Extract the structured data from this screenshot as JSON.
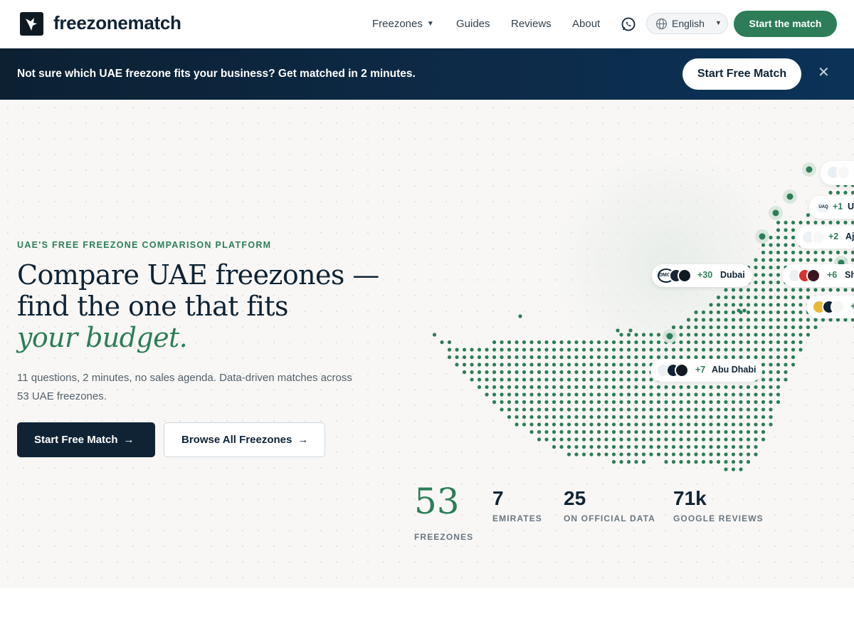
{
  "header": {
    "logo_text": "freezonematch",
    "nav": [
      "Freezones",
      "Guides",
      "Reviews",
      "About"
    ],
    "language": "English",
    "cta": "Start the match",
    "icons": {
      "logo": "bird-logo-icon",
      "whatsapp": "whatsapp-icon",
      "globe": "globe-icon",
      "dropdown": "chevron-down-icon"
    }
  },
  "banner": {
    "text": "Not sure which UAE freezone fits your business?  Get matched in 2 minutes.",
    "button": "Start Free Match",
    "close": "✕"
  },
  "hero": {
    "eyebrow": "UAE'S FREE FREEZONE COMPARISON PLATFORM",
    "headline_line1": "Compare UAE freezones —",
    "headline_line2": "find the one that fits",
    "headline_accent": "your budget.",
    "subtext": "11 questions, 2 minutes, no sales agenda. Data-driven matches across 53 UAE freezones.",
    "primary_button": "Start Free Match",
    "secondary_button": "Browse All Freezones",
    "arrow": "→"
  },
  "map": {
    "accent_color": "#2c7d58",
    "pills": [
      {
        "count": "+30",
        "name": "Dubai",
        "logo_text": "DMCC"
      },
      {
        "count": "+7",
        "name": "Abu Dhabi",
        "logo_text": ""
      },
      {
        "count": "+1",
        "name": "U",
        "logo_text": "UAQ"
      },
      {
        "count": "+2",
        "name": "Aj",
        "logo_text": ""
      },
      {
        "count": "+6",
        "name": "Sh",
        "logo_text": ""
      },
      {
        "count": "+",
        "name": "",
        "logo_text": ""
      },
      {
        "count": "",
        "name": "",
        "logo_text": ""
      }
    ]
  },
  "stats": [
    {
      "value": "53",
      "label": "FREEZONES"
    },
    {
      "value": "7",
      "label": "EMIRATES"
    },
    {
      "value": "25",
      "label": "ON OFFICIAL DATA"
    },
    {
      "value": "71k",
      "label": "GOOGLE REVIEWS"
    }
  ]
}
